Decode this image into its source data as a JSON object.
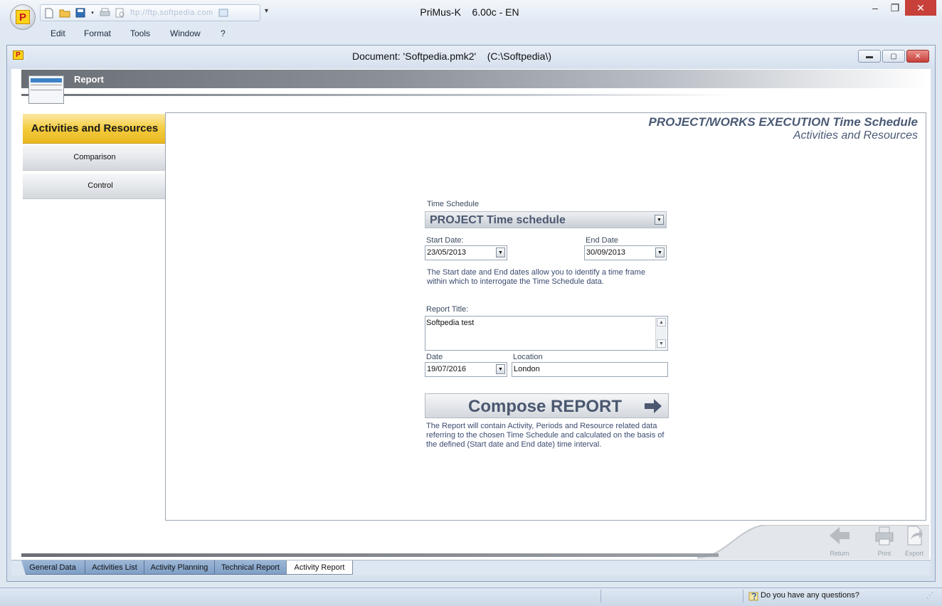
{
  "app": {
    "title": "PriMus-K    6.00c - EN",
    "logo_letter": "P",
    "qat_text": "ftp://ftp.softpedia.com"
  },
  "menu": {
    "items": [
      "Edit",
      "Format",
      "Tools",
      "Window",
      "?"
    ]
  },
  "document": {
    "title": "Document: 'Softpedia.pmk2'    (C:\\Softpedia\\)",
    "icon_letter": "P"
  },
  "header": {
    "title": "Report"
  },
  "nav": {
    "active": "Activities and Resources",
    "items": [
      "Comparison",
      "Control"
    ]
  },
  "main": {
    "title": "PROJECT/WORKS EXECUTION Time Schedule",
    "subtitle": "Activities and Resources"
  },
  "form": {
    "time_schedule_label": "Time Schedule",
    "time_schedule_value": "PROJECT Time schedule",
    "start_date_label": "Start Date:",
    "start_date_value": "23/05/2013",
    "end_date_label": "End Date",
    "end_date_value": "30/09/2013",
    "date_note": "The Start date and End dates allow you to identify a time frame within which to interrogate the Time Schedule data.",
    "report_title_label": "Report Title:",
    "report_title_value": "Softpedia test",
    "date_label": "Date",
    "date_value": "19/07/2016",
    "location_label": "Location",
    "location_value": "London",
    "compose_label": "Compose REPORT",
    "compose_note": "The Report will contain Activity, Periods and Resource related data referring to the chosen Time Schedule and calculated on the basis of the defined (Start date and End date) time interval."
  },
  "actions": {
    "return": "Return",
    "print": "Print",
    "export": "Export"
  },
  "tabs": [
    "General Data",
    "Activities List",
    "Activity Planning",
    "Technical Report",
    "Activity Report"
  ],
  "active_tab": "Activity Report",
  "status": {
    "help_text": "Do you have any questions?"
  },
  "colors": {
    "accent_yellow": "#f4cc3f",
    "title_blue": "#4a5a75",
    "tab_blue": "#8ba8cd",
    "close_red": "#c7403a"
  }
}
